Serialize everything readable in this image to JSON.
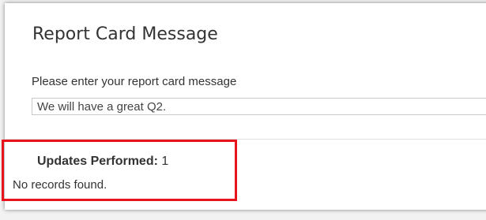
{
  "section": {
    "title": "Report Card Message",
    "prompt": "Please enter your report card message",
    "message_value": "We will have a great Q2."
  },
  "results": {
    "updates_label": "Updates Performed:",
    "updates_count": "1",
    "empty_message": "No records found."
  },
  "colors": {
    "highlight": "#e8131a",
    "page_background": "#f2f2f2",
    "panel_background": "#ffffff"
  }
}
